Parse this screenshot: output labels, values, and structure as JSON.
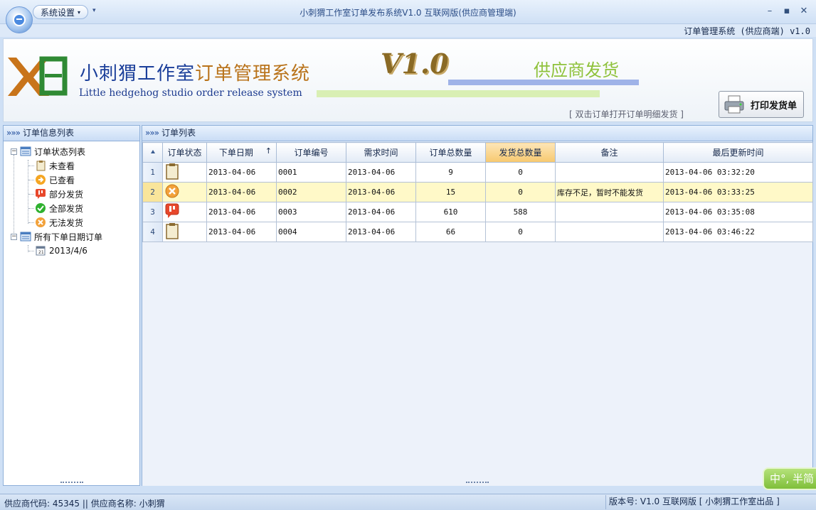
{
  "app": {
    "window_title": "小刺猬工作室订单发布系统V1.0 互联网版(供应商管理端)",
    "menu_button": "系统设置",
    "subtitle": "订单管理系统 (供应商端) v1.0"
  },
  "banner": {
    "logo_text": "XE",
    "title_part1": "小刺猬工作室",
    "title_part2": "订单管理系统",
    "title_en": "Little hedgehog studio order release system",
    "version": "V1.0",
    "supplier_label": "供应商发货",
    "hint": "[ 双击订单打开订单明细发货 ]",
    "print_button": "打印发货单"
  },
  "left_panel": {
    "header": "订单信息列表",
    "tree": {
      "root1": "订单状态列表",
      "children1": [
        "未查看",
        "已查看",
        "部分发货",
        "全部发货",
        "无法发货"
      ],
      "root2": "所有下单日期订单",
      "children2": [
        "2013/4/6"
      ]
    }
  },
  "main_panel": {
    "header": "订单列表",
    "columns": [
      "订单状态",
      "下单日期",
      "订单编号",
      "需求时间",
      "订单总数量",
      "发货总数量",
      "备注",
      "最后更新时间"
    ],
    "sort_arrow": "↑",
    "rows": [
      {
        "num": "1",
        "status_icon": "clipboard-icon",
        "order_date": "2013-04-06",
        "order_no": "0001",
        "need_date": "2013-04-06",
        "total_qty": "9",
        "shipped_qty": "0",
        "remark": "",
        "updated": "2013-04-06 03:32:20"
      },
      {
        "num": "2",
        "status_icon": "cannot-ship-icon",
        "order_date": "2013-04-06",
        "order_no": "0002",
        "need_date": "2013-04-06",
        "total_qty": "15",
        "shipped_qty": "0",
        "remark": "库存不足，暂时不能发货",
        "updated": "2013-04-06 03:33:25"
      },
      {
        "num": "3",
        "status_icon": "partial-ship-icon",
        "order_date": "2013-04-06",
        "order_no": "0003",
        "need_date": "2013-04-06",
        "total_qty": "610",
        "shipped_qty": "588",
        "remark": "",
        "updated": "2013-04-06 03:35:08"
      },
      {
        "num": "4",
        "status_icon": "clipboard-icon",
        "order_date": "2013-04-06",
        "order_no": "0004",
        "need_date": "2013-04-06",
        "total_qty": "66",
        "shipped_qty": "0",
        "remark": "",
        "updated": "2013-04-06 03:46:22"
      }
    ]
  },
  "ime": "中°, 半简",
  "statusbar": {
    "left": "供应商代码: 45345 || 供应商名称: 小刺猬",
    "right": "版本号: V1.0 互联网版 [ 小刺猬工作室出品 ]"
  },
  "colors": {
    "accent_blue": "#1b3f9a",
    "accent_orange": "#b9731a",
    "supplier_green": "#8fc23b",
    "selected_row": "#fff9c8",
    "sorted_header": "#f7c96f"
  }
}
